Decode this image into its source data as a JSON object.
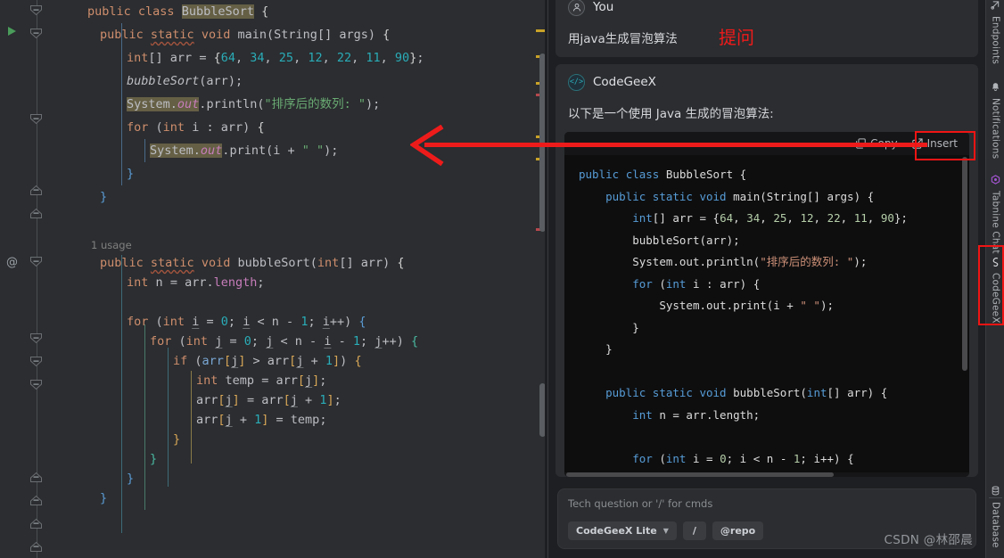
{
  "editor": {
    "gutter": {
      "run_icon": "run-triangle-icon",
      "at_icon": "@"
    },
    "usage_hint": "1 usage",
    "lines": [
      "public class BubbleSort {",
      "public static void main(String[] args) {",
      "int[] arr = {64, 34, 25, 12, 22, 11, 90};",
      "bubbleSort(arr);",
      "System.out.println(\"排序后的数列: \");",
      "for (int i : arr) {",
      "System.out.print(i + \" \");",
      "}",
      "}",
      "public static void bubbleSort(int[] arr) {",
      "int n = arr.length;",
      "for (int i = 0; i < n - 1; i++) {",
      "for (int j = 0; j < n - i - 1; j++) {",
      "if (arr[j] > arr[j + 1]) {",
      "int temp = arr[j];",
      "arr[j] = arr[j + 1];",
      "arr[j + 1] = temp;",
      "}",
      "}",
      "}",
      "}"
    ]
  },
  "chat": {
    "user": {
      "name": "You",
      "message": "用java生成冒泡算法",
      "avatar_icon": "person-icon"
    },
    "bot": {
      "name": "CodeGeeX",
      "avatar_icon": "code-brackets-icon",
      "intro": "以下是一个使用 Java 生成的冒泡算法:",
      "toolbar": {
        "copy_label": "Copy",
        "copy_icon": "copy-icon",
        "insert_label": "Insert",
        "insert_icon": "insert-external-link-icon"
      },
      "code_lines": [
        "public class BubbleSort {",
        "    public static void main(String[] args) {",
        "        int[] arr = {64, 34, 25, 12, 22, 11, 90};",
        "        bubbleSort(arr);",
        "        System.out.println(\"排序后的数列: \");",
        "        for (int i : arr) {",
        "            System.out.print(i + \" \");",
        "        }",
        "    }",
        "",
        "    public static void bubbleSort(int[] arr) {",
        "        int n = arr.length;",
        "",
        "        for (int i = 0; i < n - 1; i++) {"
      ]
    },
    "input": {
      "placeholder": "Tech question or '/' for cmds",
      "model_label": "CodeGeeX Lite",
      "model_chevron": "chevron-down-icon",
      "slash_label": "/",
      "repo_label": "@repo"
    }
  },
  "toolstrip": {
    "items": [
      {
        "label": "Endpoints",
        "icon": "endpoints-icon"
      },
      {
        "label": "Notifications",
        "icon": "bell-icon"
      },
      {
        "label": "Tabnine Chat",
        "icon": "tabnine-icon"
      },
      {
        "label": "CodeGeeX",
        "icon": "codegeex-icon"
      },
      {
        "label": "Database",
        "icon": "database-icon"
      }
    ]
  },
  "annotations": {
    "question_label": "提问",
    "arrow": "left-pointing-arrow",
    "insert_highlight_box": "red-box-around-insert",
    "codegeex_highlight_box": "red-box-around-codegeex-tab",
    "accent_color": "#ee1b1b"
  },
  "watermark": {
    "text": "CSDN @林邵晨"
  }
}
